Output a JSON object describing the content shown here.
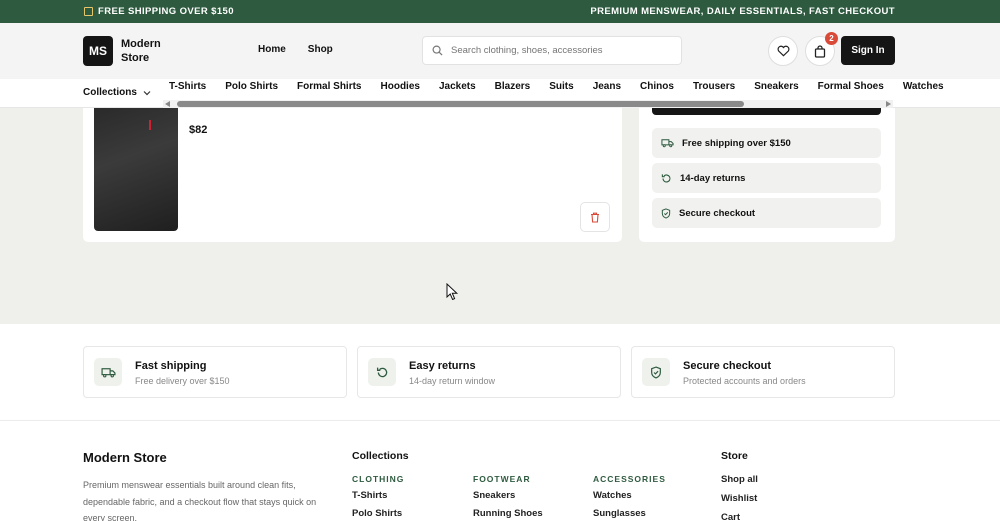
{
  "promo": {
    "left_text": "FREE SHIPPING OVER $150",
    "right_text": "PREMIUM MENSWEAR, DAILY ESSENTIALS, FAST CHECKOUT"
  },
  "header": {
    "logo_initials": "MS",
    "logo_name": "Modern Store",
    "nav": [
      "Home",
      "Shop"
    ],
    "search_placeholder": "Search clothing, shoes, accessories",
    "cart_count": "2",
    "sign_in": "Sign In"
  },
  "categories": {
    "collections_label": "Collections",
    "items": [
      "T-Shirts",
      "Polo Shirts",
      "Formal Shirts",
      "Hoodies",
      "Jackets",
      "Blazers",
      "Suits",
      "Jeans",
      "Chinos",
      "Trousers",
      "Sneakers",
      "Formal Shoes",
      "Watches"
    ]
  },
  "cart_item": {
    "price": "$82"
  },
  "summary": {
    "perks": [
      "Free shipping over $150",
      "14-day returns",
      "Secure checkout"
    ]
  },
  "features": [
    {
      "title": "Fast shipping",
      "subtitle": "Free delivery over $150"
    },
    {
      "title": "Easy returns",
      "subtitle": "14-day return window"
    },
    {
      "title": "Secure checkout",
      "subtitle": "Protected accounts and orders"
    }
  ],
  "footer": {
    "brand": "Modern Store",
    "description": "Premium menswear essentials built around clean fits, dependable fabric, and a checkout flow that stays quick on every screen.",
    "collections_heading": "Collections",
    "clothing_label": "CLOTHING",
    "clothing_links": [
      "T-Shirts",
      "Polo Shirts"
    ],
    "footwear_label": "FOOTWEAR",
    "footwear_links": [
      "Sneakers",
      "Running Shoes"
    ],
    "accessories_label": "ACCESSORIES",
    "accessories_links": [
      "Watches",
      "Sunglasses"
    ],
    "store_heading": "Store",
    "store_links": [
      "Shop all",
      "Wishlist",
      "Cart"
    ]
  },
  "colors": {
    "brand_green": "#2e5b3f",
    "badge_red": "#d94a38",
    "dark": "#151515"
  }
}
